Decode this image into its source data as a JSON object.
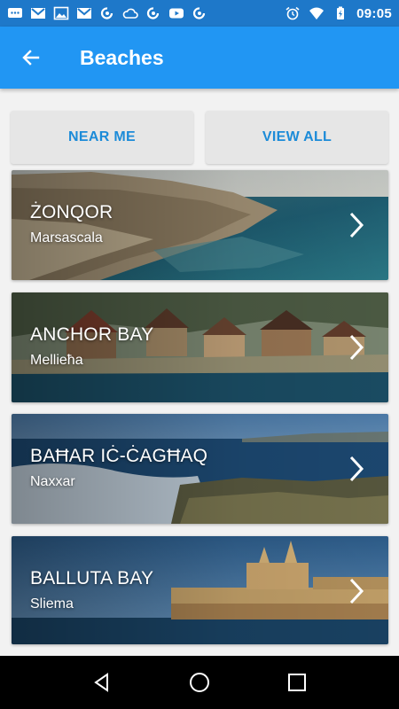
{
  "status_bar": {
    "time": "09:05",
    "left_icons": [
      "message-icon",
      "gmail-icon",
      "image-icon",
      "gmail-icon",
      "sync-icon",
      "cloud-icon",
      "sync-icon",
      "youtube-icon",
      "sync-icon"
    ],
    "right_icons": [
      "alarm-icon",
      "wifi-icon",
      "battery-charging-icon"
    ]
  },
  "app_bar": {
    "title": "Beaches",
    "back_icon": "arrow-left-icon",
    "color": "#2196f3"
  },
  "filters": {
    "near_me": "NEAR ME",
    "view_all": "VIEW ALL",
    "accent": "#1c8bd8"
  },
  "beaches": [
    {
      "name": "ŻONQOR",
      "location": "Marsascala"
    },
    {
      "name": "ANCHOR BAY",
      "location": "Mellieħa"
    },
    {
      "name": "BAĦAR IĊ-ĊAGĦAQ",
      "location": "Naxxar"
    },
    {
      "name": "BALLUTA BAY",
      "location": "Sliema"
    }
  ],
  "nav_bar": {
    "back_icon": "triangle-back-icon",
    "home_icon": "circle-home-icon",
    "recents_icon": "square-recents-icon"
  }
}
